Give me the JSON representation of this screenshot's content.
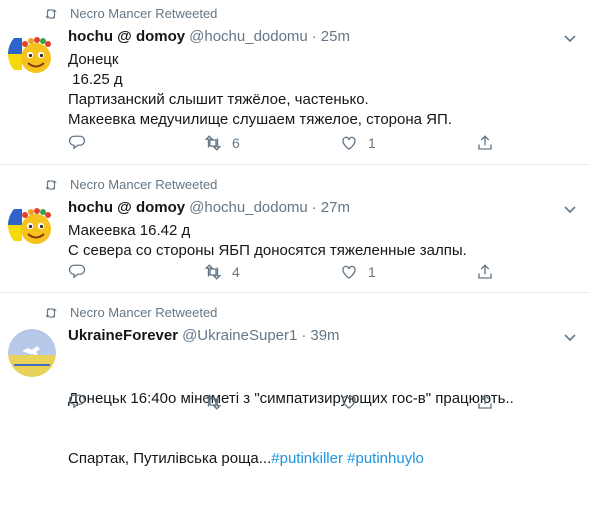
{
  "retweet_label": "Necro Mancer Retweeted",
  "tweets": [
    {
      "name": "hochu @ domoy",
      "handle": "@hochu_dodomu",
      "time": "25m",
      "lines": [
        "Донецк",
        " 16.25 д",
        "Партизанский слышит тяжёлое, частенько.",
        "Макеевка медучилище слушаем тяжелое, сторона ЯП."
      ],
      "retweets": "6",
      "likes": "1"
    },
    {
      "name": "hochu @ domoy",
      "handle": "@hochu_dodomu",
      "time": "27m",
      "lines": [
        "Макеевка 16.42 д",
        "С севера со стороны ЯБП доносятся тяжеленные залпы."
      ],
      "retweets": "4",
      "likes": "1"
    },
    {
      "name": "UkraineForever",
      "handle": "@UkraineSuper1",
      "time": "39m",
      "line1": "Донецьк 16:40о мінометі з \"симпатизирующих гос-в\" працюють..",
      "line2_prefix": "Спартак, Путилівська роща...",
      "hashtag1": "#putinkiller",
      "hashtag2": "#putinhuylo"
    }
  ],
  "icons": {
    "retweet": "retweet-icon",
    "reply": "reply-icon",
    "like": "heart-icon",
    "share": "share-icon",
    "menu": "chevron-down-icon"
  },
  "colors": {
    "secondary": "#657786",
    "link": "#1b95e0",
    "divider": "#e6ecf0"
  }
}
